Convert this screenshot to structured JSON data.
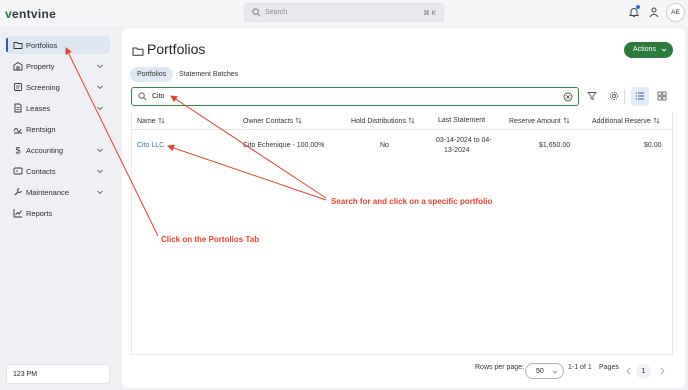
{
  "app": {
    "logo_text": "rentvine",
    "logo_v": "v"
  },
  "topbar": {
    "search_placeholder": "Search",
    "search_shortcut": "⌘ K",
    "avatar_initials": "AE"
  },
  "sidebar": {
    "items": [
      {
        "label": "Portfolios",
        "icon": "folder-icon",
        "active": true
      },
      {
        "label": "Property",
        "icon": "building-icon",
        "chevron": true
      },
      {
        "label": "Screening",
        "icon": "screening-icon",
        "chevron": true
      },
      {
        "label": "Leases",
        "icon": "document-icon",
        "chevron": true
      },
      {
        "label": "Rentsign",
        "icon": "signature-icon"
      },
      {
        "label": "Accounting",
        "icon": "dollar-icon",
        "chevron": true
      },
      {
        "label": "Contacts",
        "icon": "contact-card-icon",
        "chevron": true
      },
      {
        "label": "Maintenance",
        "icon": "wrench-icon",
        "chevron": true
      },
      {
        "label": "Reports",
        "icon": "chart-icon"
      }
    ],
    "footer_text": "123 PM"
  },
  "main": {
    "title": "Portfolios",
    "actions_label": "Actions",
    "tabs": [
      {
        "label": "Portfolios",
        "active": true
      },
      {
        "label": "Statement Batches"
      }
    ],
    "filter_value": "Cito",
    "columns": [
      "Name",
      "Owner Contacts",
      "Hold Distributions",
      "Last Statement",
      "Reserve Amount",
      "Additional Reserve"
    ],
    "rows": [
      {
        "name": "Cito LLC",
        "owner_contacts": "Cito Echenique - 100.00%",
        "hold_distributions": "No",
        "last_statement_1": "03-14-2024 to 04-",
        "last_statement_2": "13-2024",
        "reserve_amount": "$1,650.00",
        "additional_reserve": "$0.00"
      }
    ],
    "pager": {
      "rows_per_page_label": "Rows per page:",
      "rows_per_page": "50",
      "range": "1-1 of 1",
      "pages_label": "Pages",
      "current_page": "1"
    }
  },
  "annotations": {
    "search_callout": "Search for and click on a specific portfolio",
    "tab_callout": "Click on the Portolios Tab"
  },
  "colors": {
    "brand_green": "#2c7a3c",
    "link_blue": "#3a6fb5",
    "annotation_red": "#e5412f"
  }
}
